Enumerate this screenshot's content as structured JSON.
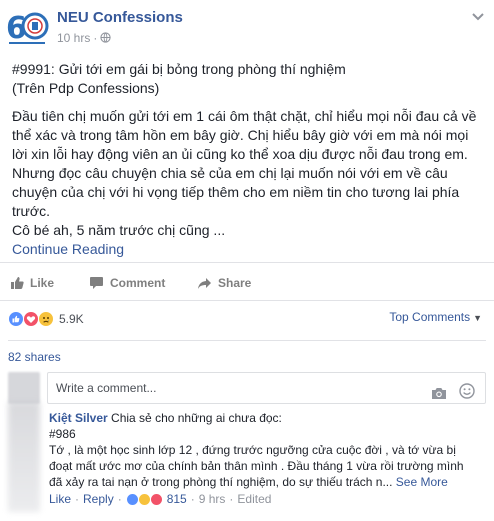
{
  "page": {
    "name": "NEU Confessions",
    "time": "10 hrs",
    "avatar_badge": "60"
  },
  "post": {
    "lines": [
      "#9991: Gửi tới em gái bị bỏng trong phòng thí nghiệm",
      "(Trên Pdp Confessions)",
      "Đầu tiên chị muốn gửi tới em 1 cái ôm thật chặt, chỉ hiểu mọi nỗi đau cả về",
      "thể xác và trong tâm hồn em bây giờ. Chị hiểu bây giờ với em mà nói mọi",
      "lời xin lỗi hay động viên an ủi cũng ko thể xoa dịu được nỗi đau trong em.",
      "Nhưng đọc câu chuyện chia sẻ của em chị lại muốn nói với em về câu",
      "chuyện của chị với hi vọng tiếp thêm cho em niềm tin cho tương lai phía",
      "trước.",
      "Cô bé ah, 5 năm trước chị cũng ..."
    ],
    "continue_label": "Continue Reading"
  },
  "actions": {
    "like": "Like",
    "comment": "Comment",
    "share": "Share"
  },
  "stats": {
    "reactions_count": "5.9K",
    "top_comments": "Top Comments",
    "shares": "82 shares"
  },
  "comment_input": {
    "placeholder": "Write a comment..."
  },
  "comment": {
    "author": "Kiệt Silver",
    "lead": "Chia sẻ cho những ai chưa đọc:",
    "lines": [
      "#986",
      "Tớ , là một học sinh lớp 12 , đứng trước ngưỡng cửa cuộc đời , và tớ vừa bị",
      "đoạt mất ước mơ của chính bản thân mình . Đầu tháng 1 vừa rồi trường mình",
      "đã xảy ra tai nạn ở trong phòng thí nghiệm, do sự thiếu trách n..."
    ],
    "see_more": "See More",
    "like": "Like",
    "reply": "Reply",
    "reaction_count": "815",
    "time": "9 hrs",
    "edited": "Edited"
  },
  "colors": {
    "link": "#365899",
    "meta": "#90949c",
    "like_blue": "#5890ff",
    "love_red": "#f25268",
    "sad_yellow": "#f7c23c"
  },
  "icons": [
    "globe-icon",
    "chevron-down-icon",
    "like-icon",
    "comment-icon",
    "share-icon",
    "camera-icon",
    "smiley-icon"
  ]
}
